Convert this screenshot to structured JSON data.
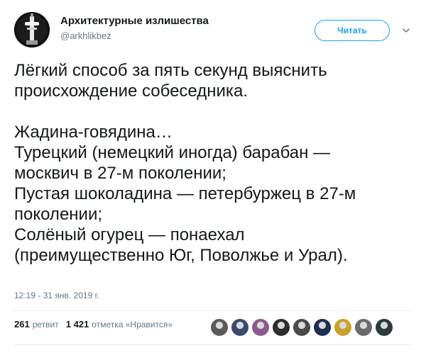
{
  "author": {
    "display_name": "Архитектурные излишества",
    "handle": "@arkhlikbez",
    "avatar_icon": "tower-avatar-icon"
  },
  "follow_button": {
    "label": "Читать"
  },
  "menu_icon": "chevron-down-icon",
  "tweet": {
    "lines": [
      "Лёгкий способ за пять секунд выяснить",
      "происхождение собеседника.",
      "",
      "Жадина-говядина…",
      "Турецкий (немецкий иногда) барабан —",
      "москвич в 27-м поколении;",
      "Пустая шоколадина — петербуржец в 27-м",
      "поколении;",
      "Солёный огурец — понаехал",
      "(преимущественно Юг, Поволжье и Урал)."
    ],
    "timestamp": "12:19 - 31 янв. 2019 г."
  },
  "stats": {
    "retweets_count": "261",
    "retweets_label": "ретвит",
    "likes_count": "1 421",
    "likes_label": "отметка «Нравится»"
  },
  "likers": [
    {
      "name": "liker-avatar-1",
      "color": "#5a5a5a"
    },
    {
      "name": "liker-avatar-2",
      "color": "#3b4a6b"
    },
    {
      "name": "liker-avatar-3",
      "color": "#8b5a8c"
    },
    {
      "name": "liker-avatar-4",
      "color": "#2e2e2e"
    },
    {
      "name": "liker-avatar-5",
      "color": "#4a4a4a"
    },
    {
      "name": "liker-avatar-6",
      "color": "#1f2f4f"
    },
    {
      "name": "liker-avatar-7",
      "color": "#c9a227"
    },
    {
      "name": "liker-avatar-8",
      "color": "#6b6b6b"
    },
    {
      "name": "liker-avatar-9",
      "color": "#2b3b3b"
    }
  ],
  "colors": {
    "accent": "#1da1f2",
    "secondary_text": "#657786",
    "primary_text": "#14171a",
    "divider": "#e6ecf0"
  }
}
